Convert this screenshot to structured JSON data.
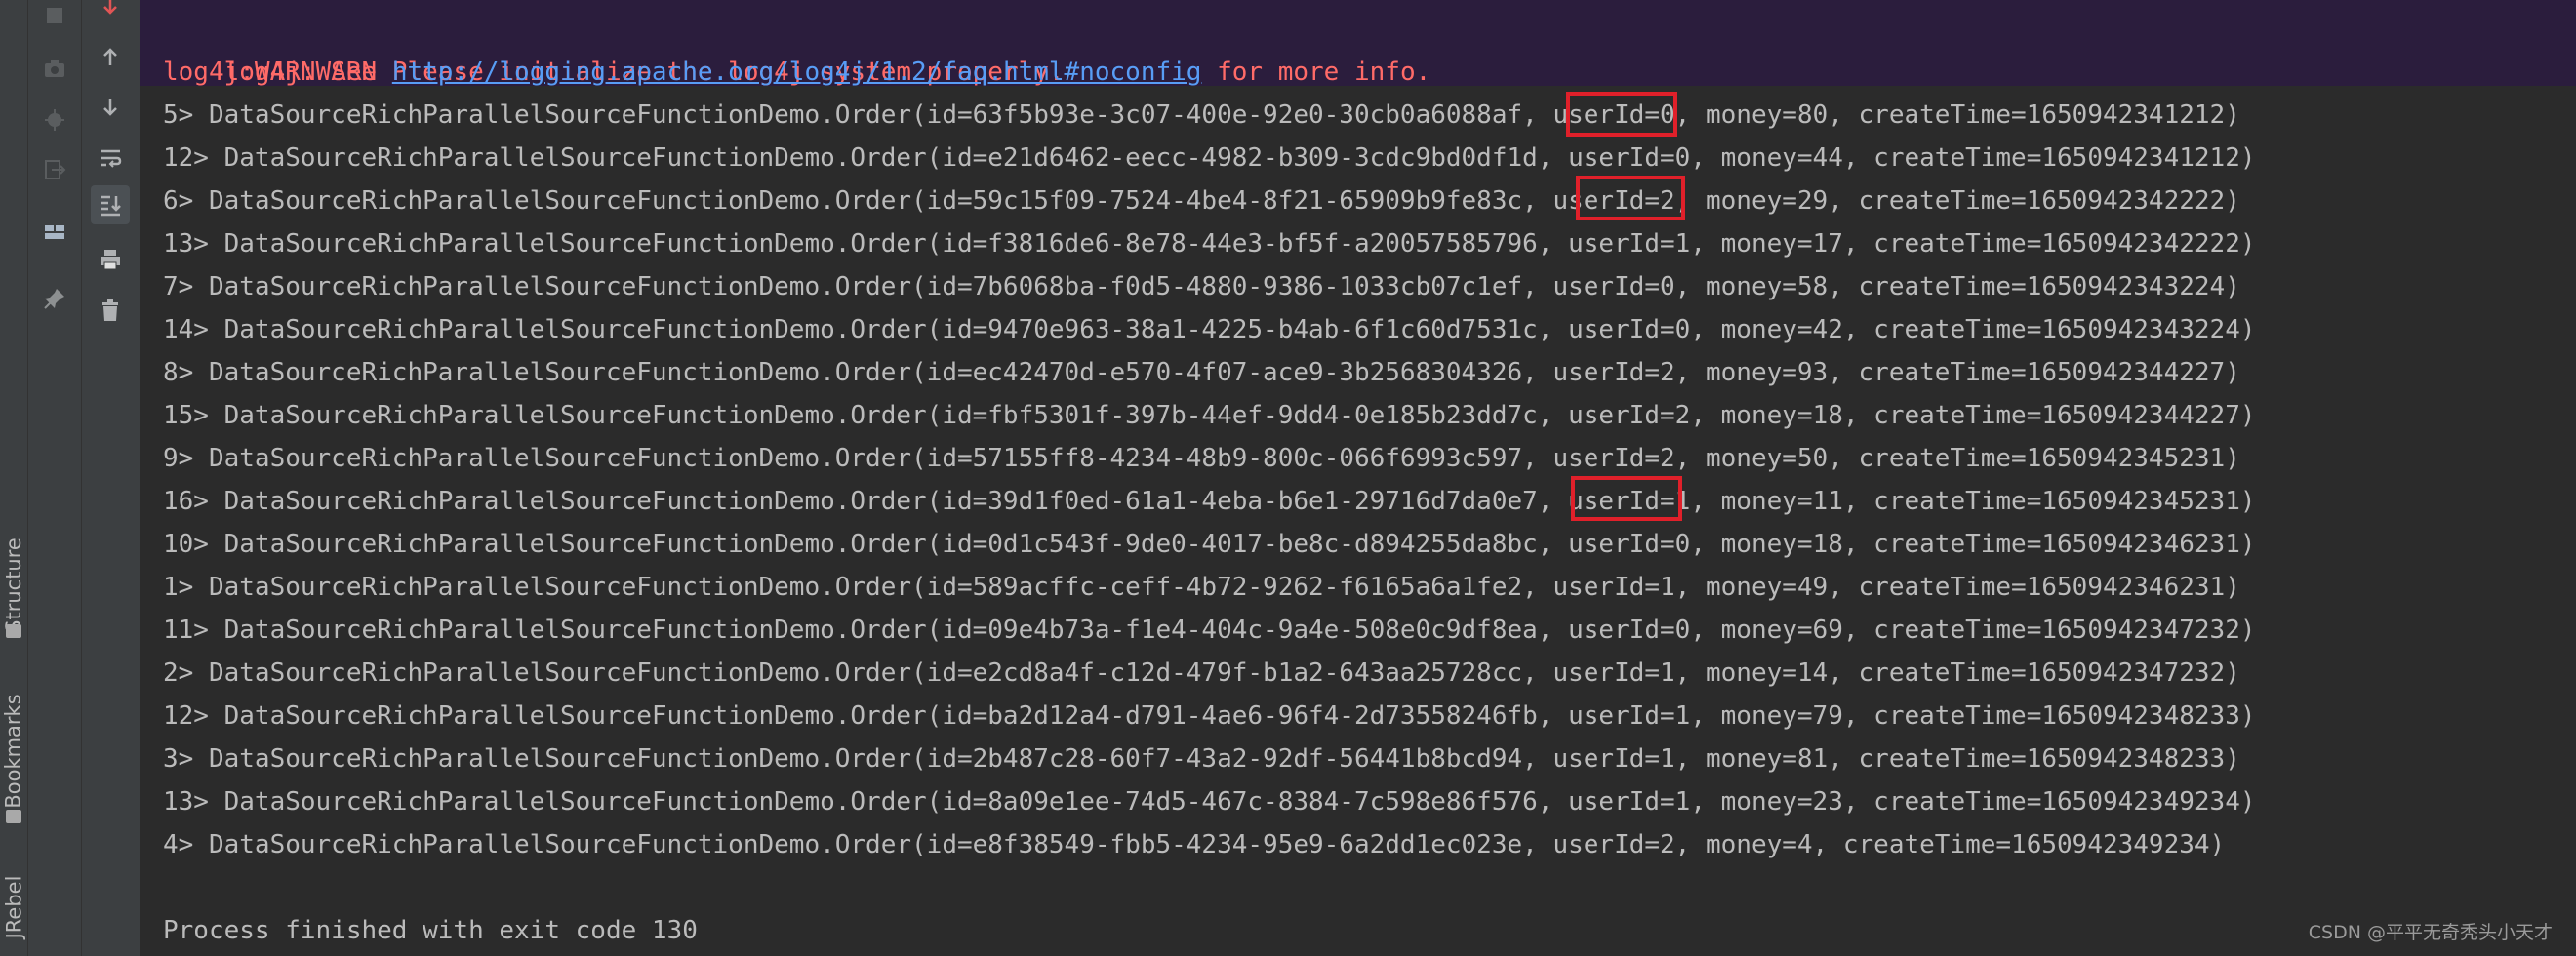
{
  "sidebar": {
    "labels": [
      "Structure",
      "Bookmarks",
      "JRebel"
    ]
  },
  "toolbar": {
    "left_icons": [
      "stop-icon",
      "camera-icon",
      "bug-settings-icon",
      "exit-icon",
      "layout-icon",
      "pin-icon"
    ],
    "right_icons": [
      "down-arrow-icon",
      "up-arrow-icon",
      "down-icon",
      "soft-wrap-icon",
      "scroll-to-end-icon",
      "print-icon",
      "trash-icon"
    ]
  },
  "console": {
    "warnings": {
      "line1": "log4j:WARN Please initialize the log4j system properly.",
      "line2_prefix": "log4j:WARN See ",
      "line2_link": "http://logging.apache.org/log4j/1.2/faq.html#noconfig",
      "line2_suffix": " for more info."
    },
    "lines": [
      "5> DataSourceRichParallelSourceFunctionDemo.Order(id=63f5b93e-3c07-400e-92e0-30cb0a6088af, userId=0, money=80, createTime=1650942341212)",
      "12> DataSourceRichParallelSourceFunctionDemo.Order(id=e21d6462-eecc-4982-b309-3cdc9bd0df1d, userId=0, money=44, createTime=1650942341212)",
      "6> DataSourceRichParallelSourceFunctionDemo.Order(id=59c15f09-7524-4be4-8f21-65909b9fe83c, userId=2, money=29, createTime=1650942342222)",
      "13> DataSourceRichParallelSourceFunctionDemo.Order(id=f3816de6-8e78-44e3-bf5f-a20057585796, userId=1, money=17, createTime=1650942342222)",
      "7> DataSourceRichParallelSourceFunctionDemo.Order(id=7b6068ba-f0d5-4880-9386-1033cb07c1ef, userId=0, money=58, createTime=1650942343224)",
      "14> DataSourceRichParallelSourceFunctionDemo.Order(id=9470e963-38a1-4225-b4ab-6f1c60d7531c, userId=0, money=42, createTime=1650942343224)",
      "8> DataSourceRichParallelSourceFunctionDemo.Order(id=ec42470d-e570-4f07-ace9-3b2568304326, userId=2, money=93, createTime=1650942344227)",
      "15> DataSourceRichParallelSourceFunctionDemo.Order(id=fbf5301f-397b-44ef-9dd4-0e185b23dd7c, userId=2, money=18, createTime=1650942344227)",
      "9> DataSourceRichParallelSourceFunctionDemo.Order(id=57155ff8-4234-48b9-800c-066f6993c597, userId=2, money=50, createTime=1650942345231)",
      "16> DataSourceRichParallelSourceFunctionDemo.Order(id=39d1f0ed-61a1-4eba-b6e1-29716d7da0e7, userId=1, money=11, createTime=1650942345231)",
      "10> DataSourceRichParallelSourceFunctionDemo.Order(id=0d1c543f-9de0-4017-be8c-d894255da8bc, userId=0, money=18, createTime=1650942346231)",
      "1> DataSourceRichParallelSourceFunctionDemo.Order(id=589acffc-ceff-4b72-9262-f6165a6a1fe2, userId=1, money=49, createTime=1650942346231)",
      "11> DataSourceRichParallelSourceFunctionDemo.Order(id=09e4b73a-f1e4-404c-9a4e-508e0c9df8ea, userId=0, money=69, createTime=1650942347232)",
      "2> DataSourceRichParallelSourceFunctionDemo.Order(id=e2cd8a4f-c12d-479f-b1a2-643aa25728cc, userId=1, money=14, createTime=1650942347232)",
      "12> DataSourceRichParallelSourceFunctionDemo.Order(id=ba2d12a4-d791-4ae6-96f4-2d73558246fb, userId=1, money=79, createTime=1650942348233)",
      "3> DataSourceRichParallelSourceFunctionDemo.Order(id=2b487c28-60f7-43a2-92df-56441b8bcd94, userId=1, money=81, createTime=1650942348233)",
      "13> DataSourceRichParallelSourceFunctionDemo.Order(id=8a09e1ee-74d5-467c-8384-7c598e86f576, userId=1, money=23, createTime=1650942349234)",
      "4> DataSourceRichParallelSourceFunctionDemo.Order(id=e8f38549-fbb5-4234-95e9-6a2dd1ec023e, userId=2, money=4, createTime=1650942349234)"
    ],
    "exit_message": "Process finished with exit code 130"
  },
  "watermark": "CSDN @平平无奇秃头小天才",
  "colors": {
    "background": "#2b2b2b",
    "warning_text": "#ff6b68",
    "link": "#589df6",
    "highlight_box": "#e0202a",
    "output_text": "#bbbbbb"
  }
}
